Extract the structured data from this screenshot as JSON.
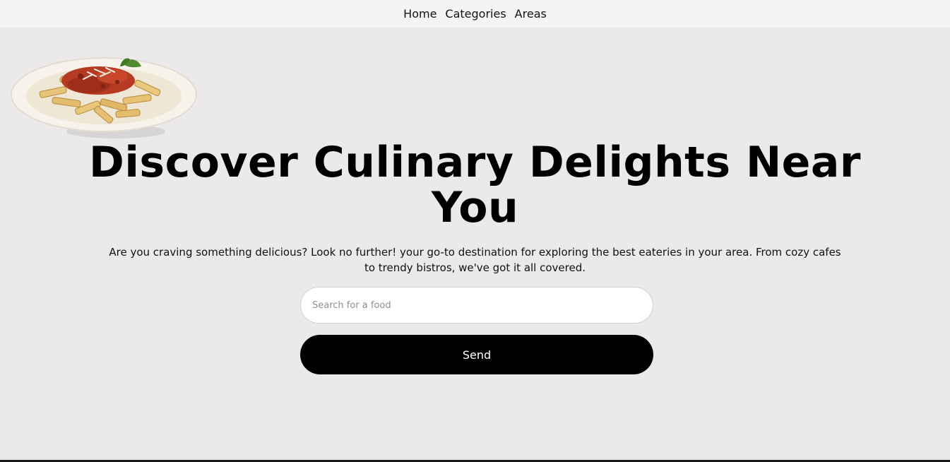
{
  "nav": {
    "items": [
      {
        "label": "Home"
      },
      {
        "label": "Categories"
      },
      {
        "label": "Areas"
      }
    ]
  },
  "hero": {
    "title_line1": "Discover Culinary Delights Near",
    "title_line2": "You",
    "description": "Are you craving something delicious? Look no further! your go-to destination for exploring the best eateries in your area. From cozy cafes to trendy bistros, we've got it all covered."
  },
  "search": {
    "placeholder": "Search for a food",
    "value": ""
  },
  "send_button": {
    "label": "Send"
  },
  "colors": {
    "page_background": "#ebe9e9",
    "navbar_background": "#f4f4f4",
    "button_background": "#000000",
    "button_text": "#ffffff"
  },
  "icons": {
    "hero_image": "pasta-plate-image"
  }
}
